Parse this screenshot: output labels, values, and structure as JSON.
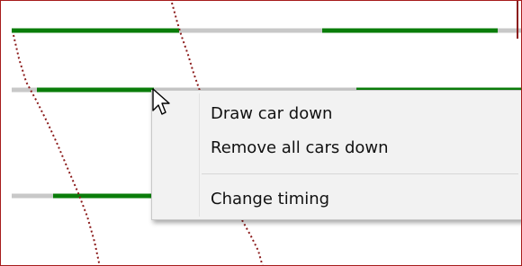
{
  "context_menu": {
    "items": [
      {
        "label": "Draw car down"
      },
      {
        "label": "Remove all cars down"
      },
      {
        "label": "Change timing"
      }
    ]
  },
  "diagram": {
    "track_color": "#c8c8c8",
    "car_color": "#0a7d0a",
    "path_color": "#8b1a1a",
    "frame_color": "#a61c1c"
  }
}
